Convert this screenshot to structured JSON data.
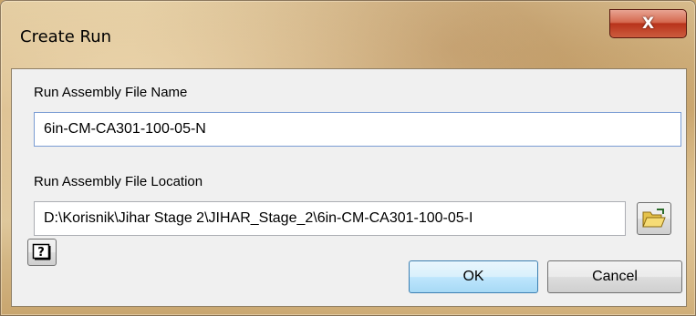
{
  "window": {
    "title": "Create Run",
    "close_glyph": "X"
  },
  "form": {
    "name_label": "Run Assembly File Name",
    "name_value": "6in-CM-CA301-100-05-N",
    "location_label": "Run Assembly File Location",
    "location_value": "D:\\Korisnik\\Jihar Stage 2\\JIHAR_Stage_2\\6in-CM-CA301-100-05-I"
  },
  "buttons": {
    "browse_icon": "folder-open-icon",
    "help_icon": "help-icon",
    "ok_label": "OK",
    "cancel_label": "Cancel"
  }
}
